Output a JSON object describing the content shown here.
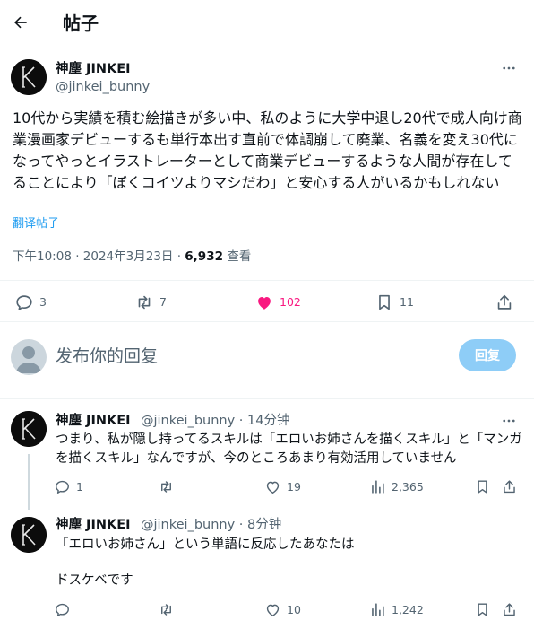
{
  "header": {
    "title": "帖子"
  },
  "post": {
    "author_name": "神塵 JINKEI",
    "author_handle": "@jinkei_bunny",
    "text": "10代から実績を積む絵描きが多い中、私のように大学中退し20代で成人向け商業漫画家デビューするも単行本出す直前で体調崩して廃業、名義を変え30代になってやっとイラストレーターとして商業デビューするような人間が存在してることにより「ぼくコイツよりマシだわ」と安心する人がいるかもしれない",
    "translate_label": "翻译帖子",
    "timestamp": "下午10:08 · 2024年3月23日 · ",
    "views_count": "6,932",
    "views_label": " 查看",
    "stats": {
      "replies": "3",
      "reposts": "7",
      "likes": "102",
      "bookmarks": "11"
    }
  },
  "reply_box": {
    "placeholder": "发布你的回复",
    "button_label": "回复"
  },
  "comments": [
    {
      "author_name": "神塵 JINKEI",
      "meta": "@jinkei_bunny · 14分钟",
      "text": "つまり、私が隠し持ってるスキルは「エロいお姉さんを描くスキル」と「マンガを描くスキル」なんですが、今のところあまり有効活用していません",
      "stats": {
        "replies": "1",
        "likes": "19",
        "views": "2,365"
      }
    },
    {
      "author_name": "神塵 JINKEI",
      "meta": "@jinkei_bunny · 8分钟",
      "text_line1": "「エロいお姉さん」という単語に反応したあなたは",
      "text_line2": "ドスケベです",
      "stats": {
        "likes": "10",
        "views": "1,242"
      }
    }
  ],
  "colors": {
    "accent": "#1d9bf0",
    "like": "#f91880",
    "muted": "#536471",
    "reply_button": "#8ecdf7"
  },
  "icons": [
    "back-arrow-icon",
    "more-icon",
    "reply-icon",
    "repost-icon",
    "like-icon",
    "bookmark-icon",
    "share-icon",
    "views-icon",
    "avatar-k-logo"
  ]
}
